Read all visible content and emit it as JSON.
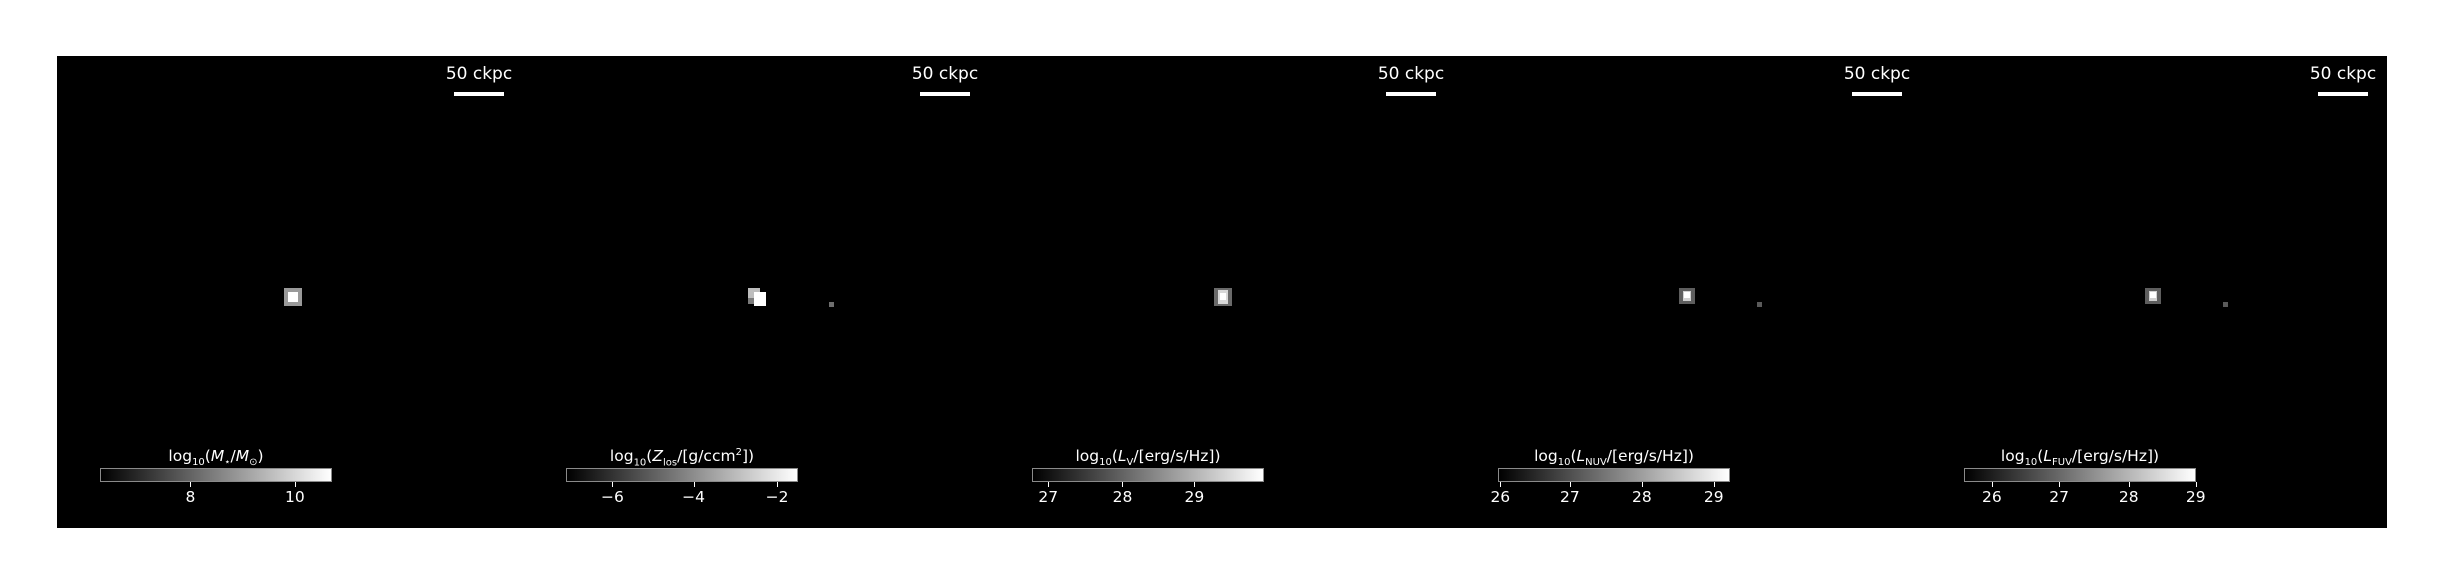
{
  "panels": [
    {
      "scale_label": "50 ckpc",
      "colorbar_label_html": "log<sub>10</sub>(<i>M</i><sub>⋆</sub>/<i>M</i><sub>⊙</sub>)",
      "ticks": [
        {
          "label": "8",
          "frac": 0.39
        },
        {
          "label": "10",
          "frac": 0.84
        }
      ]
    },
    {
      "scale_label": "50 ckpc",
      "colorbar_label_html": "log<sub>10</sub>(<i>Z</i><sub>los</sub>/[g/ccm<sup>2</sup>])",
      "ticks": [
        {
          "label": "−6",
          "frac": 0.2
        },
        {
          "label": "−4",
          "frac": 0.55
        },
        {
          "label": "−2",
          "frac": 0.91
        }
      ]
    },
    {
      "scale_label": "50 ckpc",
      "colorbar_label_html": "log<sub>10</sub>(<i>L</i><sub>V</sub>/[erg/s/Hz])",
      "ticks": [
        {
          "label": "27",
          "frac": 0.07
        },
        {
          "label": "28",
          "frac": 0.39
        },
        {
          "label": "29",
          "frac": 0.7
        }
      ]
    },
    {
      "scale_label": "50 ckpc",
      "colorbar_label_html": "log<sub>10</sub>(<i>L</i><sub>NUV</sub>/[erg/s/Hz])",
      "ticks": [
        {
          "label": "26",
          "frac": 0.01
        },
        {
          "label": "27",
          "frac": 0.31
        },
        {
          "label": "28",
          "frac": 0.62
        },
        {
          "label": "29",
          "frac": 0.93
        }
      ]
    },
    {
      "scale_label": "50 ckpc",
      "colorbar_label_html": "log<sub>10</sub>(<i>L</i><sub>FUV</sub>/[erg/s/Hz])",
      "ticks": [
        {
          "label": "26",
          "frac": 0.12
        },
        {
          "label": "27",
          "frac": 0.41
        },
        {
          "label": "28",
          "frac": 0.71
        },
        {
          "label": "29",
          "frac": 1.0
        }
      ]
    }
  ]
}
